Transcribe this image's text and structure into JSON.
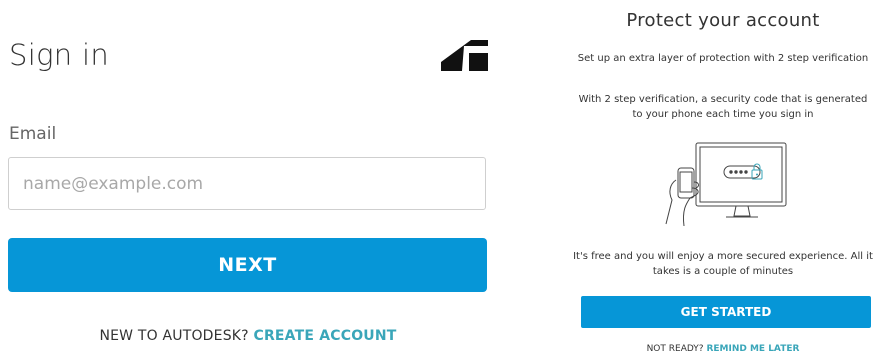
{
  "signin": {
    "title": "Sign in",
    "logo_icon": "autodesk-logo-icon",
    "email_label": "Email",
    "email_placeholder": "name@example.com",
    "email_value": "",
    "next_label": "NEXT",
    "new_prompt": "NEW TO AUTODESK?",
    "create_account_label": "CREATE ACCOUNT"
  },
  "protect": {
    "title": "Protect your account",
    "subtitle": "Set up an extra layer of protection with 2 step verification",
    "description_line1": "With 2 step verification, a security code that is generated",
    "description_line2": "to your phone each time you sign in",
    "illustration_icon": "phone-monitor-lock-icon",
    "benefit_line1": "It's free and you will enjoy a more secured experience. All it",
    "benefit_line2": "takes is a couple of minutes",
    "get_started_label": "GET STARTED",
    "not_ready_prompt": "NOT READY?",
    "remind_later_label": "REMIND ME LATER"
  },
  "colors": {
    "primary_button": "#0696d7",
    "link": "#3aa6b9",
    "text": "#333333"
  }
}
